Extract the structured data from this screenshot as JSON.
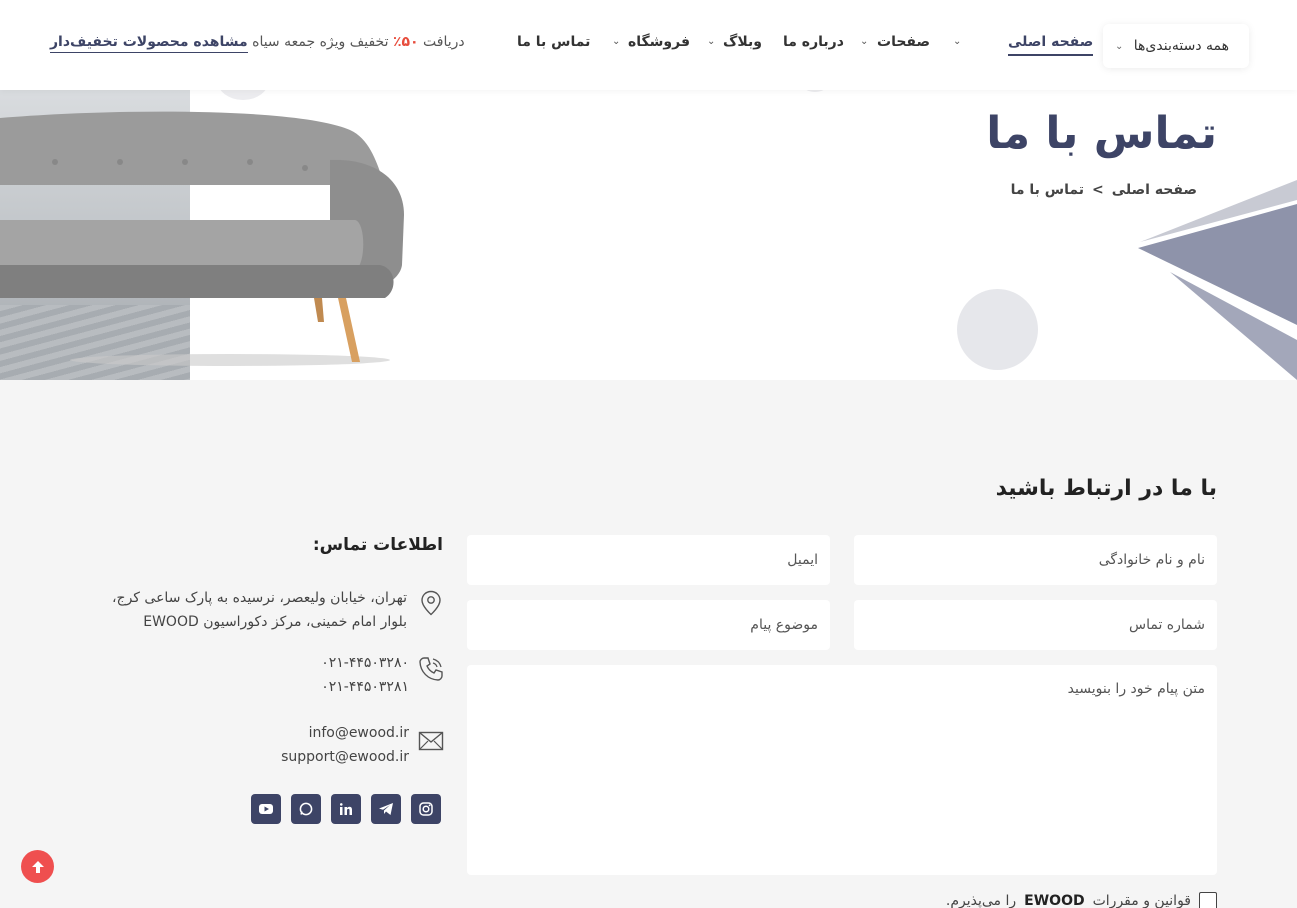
{
  "header": {
    "categories_label": "همه دسته‌بندی‌ها",
    "nav": {
      "home": "صفحه اصلی",
      "pages": "صفحات",
      "about": "درباره ما",
      "blog": "وبلاگ",
      "shop": "فروشگاه",
      "contact": "تماس با ما"
    },
    "promo": {
      "prefix": "دریافت",
      "percent": "۵۰٪",
      "middle": "تخفیف ویژه جمعه سیاه",
      "link": "مشاهده محصولات تخفیف‌دار"
    }
  },
  "hero": {
    "title": "تماس با ما",
    "breadcrumb": {
      "home": "صفحه اصلی",
      "separator": ">",
      "current": "تماس با ما"
    }
  },
  "contact": {
    "section_title": "با ما در ارتباط باشید",
    "form": {
      "name_placeholder": "نام و نام خانوادگی",
      "email_placeholder": "ایمیل",
      "phone_placeholder": "شماره تماس",
      "subject_placeholder": "موضوع پیام",
      "message_placeholder": "متن پیام خود را بنویسید",
      "terms_prefix": "قوانین و مقررات",
      "terms_brand": "EWOOD",
      "terms_suffix": "را می‌پذیرم."
    },
    "info": {
      "title": "اطلاعات تماس:",
      "address_line1": "تهران، خیابان ولیعصر، نرسیده به پارک ساعی کرج،",
      "address_line2": "بلوار امام خمینی، مرکز دکوراسیون EWOOD",
      "phone1": "۰۲۱-۴۴۵۰۳۲۸۰",
      "phone2": "۰۲۱-۴۴۵۰۳۲۸۱",
      "email1": "info@ewood.ir",
      "email2": "support@ewood.ir"
    },
    "socials": [
      {
        "icon": "youtube-icon"
      },
      {
        "icon": "whatsapp-icon"
      },
      {
        "icon": "linkedin-icon"
      },
      {
        "icon": "telegram-icon"
      },
      {
        "icon": "instagram-icon"
      }
    ]
  },
  "colors": {
    "accent": "#3d4466",
    "promo_red": "#e74c3c",
    "scroll_top": "#ef4f4f",
    "background": "#f5f5f5"
  }
}
